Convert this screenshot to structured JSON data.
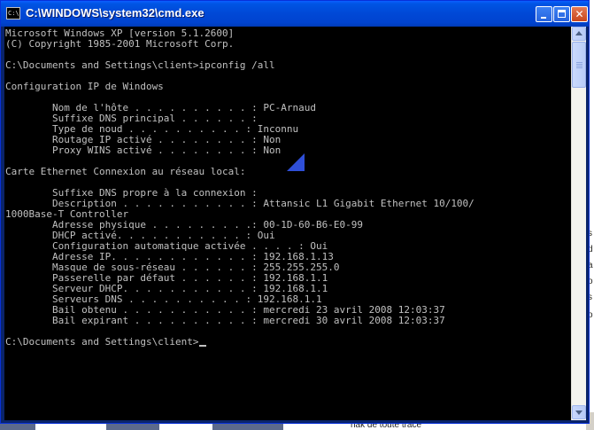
{
  "window": {
    "title": "C:\\WINDOWS\\system32\\cmd.exe",
    "icon": "console-icon",
    "icon_label": "C:\\"
  },
  "console": {
    "lines": [
      "Microsoft Windows XP [version 5.1.2600]",
      "(C) Copyright 1985-2001 Microsoft Corp.",
      "",
      "C:\\Documents and Settings\\client>ipconfig /all",
      "",
      "Configuration IP de Windows",
      "",
      "        Nom de l'hôte . . . . . . . . . . : PC-Arnaud",
      "        Suffixe DNS principal . . . . . . :",
      "        Type de noud . . . . . . . . . . : Inconnu",
      "        Routage IP activé . . . . . . . . : Non",
      "        Proxy WINS activé . . . . . . . . : Non",
      "",
      "Carte Ethernet Connexion au réseau local:",
      "",
      "        Suffixe DNS propre à la connexion :",
      "        Description . . . . . . . . . . . : Attansic L1 Gigabit Ethernet 10/100/",
      "1000Base-T Controller",
      "        Adresse physique . . . . . . . . .: 00-1D-60-B6-E0-99",
      "        DHCP activé. . . . . . . . . . . : Oui",
      "        Configuration automatique activée . . . . : Oui",
      "        Adresse IP. . . . . . . . . . . . : 192.168.1.13",
      "        Masque de sous-réseau . . . . . . : 255.255.255.0",
      "        Passerelle par défaut . . . . . . : 192.168.1.1",
      "        Serveur DHCP. . . . . . . . . . . : 192.168.1.1",
      "        Serveurs DNS . . . . . . . . . . : 192.168.1.1",
      "        Bail obtenu . . . . . . . . . . . : mercredi 23 avril 2008 12:03:37",
      "        Bail expirant . . . . . . . . . . : mercredi 30 avril 2008 12:03:37",
      "",
      "C:\\Documents and Settings\\client>"
    ]
  },
  "background": {
    "right_chars": [
      "s",
      "d",
      "a",
      "o",
      "s",
      "o"
    ],
    "bottom_text": "nak de toute trace"
  },
  "colors": {
    "titlebar": "#0054e3",
    "console_bg": "#000000",
    "console_fg": "#c0c0c0"
  }
}
